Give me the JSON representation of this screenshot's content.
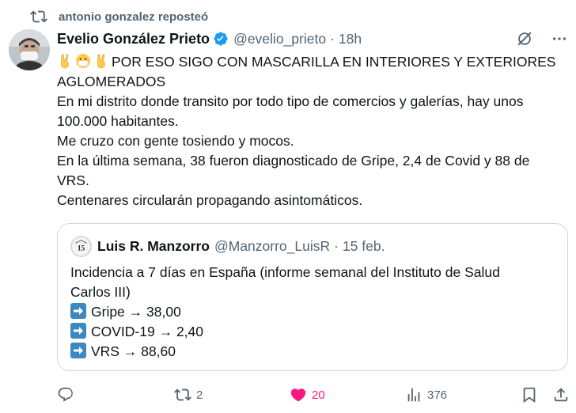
{
  "repost": {
    "text": "antonio gonzalez reposteó",
    "icon": "repost-icon"
  },
  "tweet": {
    "author_name": "Evelio González Prieto",
    "verified": true,
    "handle": "@evelio_prieto",
    "separator": "·",
    "time": "18h",
    "line1_emojis": [
      "victory-hand",
      "face-with-mask",
      "victory-hand"
    ],
    "lines": [
      "POR ESO SIGO CON MASCARILLA EN INTERIORES Y EXTERIORES",
      "AGLOMERADOS",
      "En mi distrito donde transito por todo tipo de comercios y galerías, hay unos",
      "100.000 habitantes.",
      "Me cruzo con gente tosiendo y mocos.",
      "En la última semana, 38 fueron diagnosticado de Gripe, 2,4 de Covid y 88 de",
      "VRS.",
      "Centenares circularán propagando asintomáticos."
    ]
  },
  "quote": {
    "author_name": "Luis R. Manzorro",
    "handle": "@Manzorro_LuisR",
    "separator": "·",
    "time": "15 feb.",
    "avatar_text": "15",
    "lines": [
      "Incidencia a 7 días en España (informe semanal del Instituto de Salud",
      "Carlos III)"
    ],
    "bullets": [
      "Gripe → 38,00",
      "COVID-19 → 2,40",
      "VRS → 88,60"
    ],
    "bullet_icon": "right-arrow-emoji"
  },
  "actions": {
    "reply_count": "",
    "repost_count": "2",
    "like_count": "20",
    "views_count": "376"
  },
  "colors": {
    "like": "#f91880",
    "verified": "#1d9bf0",
    "secondary_text": "#536471",
    "arrow_box": "#3b88c3"
  }
}
